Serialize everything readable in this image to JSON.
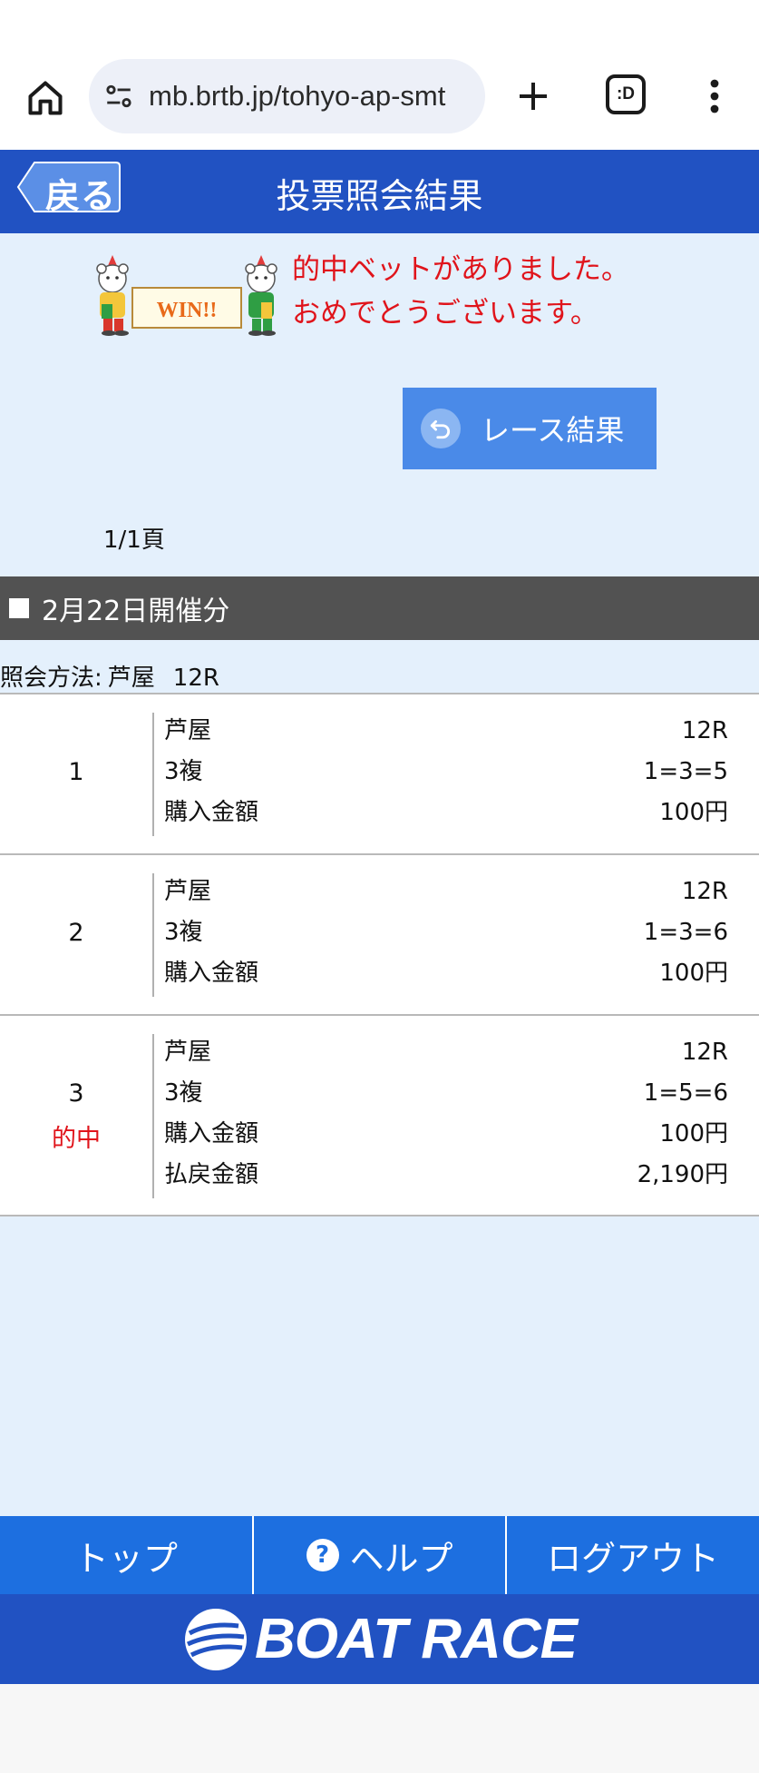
{
  "browser": {
    "url": "mb.brtb.jp/tohyo-ap-smt",
    "tab_switcher_label": ":D",
    "icons": [
      "home-icon",
      "site-settings-icon",
      "plus-icon",
      "tab-switcher-icon",
      "more-vert-icon"
    ]
  },
  "header": {
    "back_label": "戻る",
    "title": "投票照会結果"
  },
  "win": {
    "logo_text": "WIN!!",
    "message_line1": "的中ベットがありました。",
    "message_line2": "おめでとうございます。"
  },
  "race_result_button": {
    "label": "レース結果",
    "icon": "undo-arrow-icon"
  },
  "page_count": "1/1頁",
  "date_header": "2月22日開催分",
  "inquiry": {
    "label": "照会方法:",
    "venue": "芦屋",
    "race": "12R"
  },
  "bets": [
    {
      "number": "1",
      "hit": "",
      "lines": [
        {
          "label": "芦屋",
          "value": "12R"
        },
        {
          "label": "3複",
          "value": "1=3=5"
        },
        {
          "label": "購入金額",
          "value": "100円"
        }
      ]
    },
    {
      "number": "2",
      "hit": "",
      "lines": [
        {
          "label": "芦屋",
          "value": "12R"
        },
        {
          "label": "3複",
          "value": "1=3=6"
        },
        {
          "label": "購入金額",
          "value": "100円"
        }
      ]
    },
    {
      "number": "3",
      "hit": "的中",
      "lines": [
        {
          "label": "芦屋",
          "value": "12R"
        },
        {
          "label": "3複",
          "value": "1=5=6"
        },
        {
          "label": "購入金額",
          "value": "100円"
        },
        {
          "label": "払戻金額",
          "value": "2,190円"
        }
      ]
    }
  ],
  "footer": {
    "top": "トップ",
    "help": "ヘルプ",
    "logout": "ログアウト",
    "brand": "BOAT RACE"
  },
  "colors": {
    "header_blue": "#2152c2",
    "nav_blue": "#1d6fe0",
    "page_bg": "#e4f0fc",
    "hit_red": "#e0141b",
    "date_bar_gray": "#525252",
    "button_blue": "#4a8ae8"
  }
}
